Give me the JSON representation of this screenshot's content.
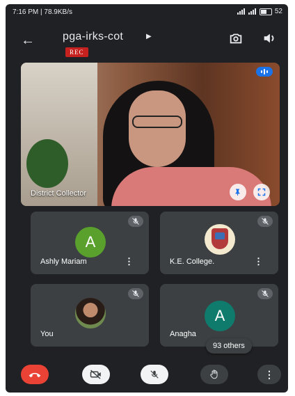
{
  "status_bar": {
    "time_speed": "7:16 PM | 78.9KB/s",
    "battery": "52"
  },
  "header": {
    "meeting_code": "pga-irks-cot",
    "rec_label": "REC"
  },
  "main_tile": {
    "name": "District Collector"
  },
  "tiles": [
    {
      "name": "Ashly Mariam",
      "avatar_letter": "A",
      "avatar_color": "#5aa02c"
    },
    {
      "name": "K.E. College."
    },
    {
      "name": "You"
    },
    {
      "name": "Anagha",
      "avatar_letter": "A",
      "avatar_color": "#0f7b6c"
    }
  ],
  "others_label": "93 others",
  "colors": {
    "background": "#202124",
    "tile": "#3c4043",
    "end_call": "#ea4335",
    "rec": "#c5221f",
    "speaking": "#1a73e8"
  },
  "icons": [
    "back-arrow-icon",
    "switch-camera-icon",
    "speaker-icon",
    "audio-level-icon",
    "pin-icon",
    "fullscreen-icon",
    "mic-off-icon",
    "more-vert-icon",
    "end-call-icon",
    "camera-off-icon",
    "raise-hand-icon"
  ]
}
